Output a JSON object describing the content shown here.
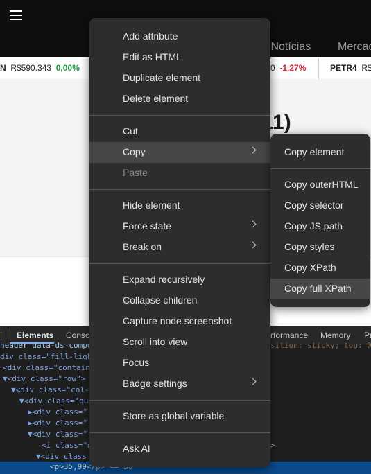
{
  "page": {
    "nav_links": [
      "s Notícias",
      "Mercad"
    ],
    "ticker": [
      {
        "symbol": "N",
        "price": "R$590.343",
        "change": "0,00%",
        "dir": "up"
      },
      {
        "symbol": "",
        "price": "0",
        "change": "-1,27%",
        "dir": "down"
      },
      {
        "symbol": "PETR4",
        "price": "R$",
        "change": "",
        "dir": ""
      }
    ],
    "headline_fragment": "11)"
  },
  "devtools": {
    "tabs": [
      "Elements",
      "Conso",
      "rformance",
      "Memory",
      "Pr"
    ],
    "active_tab": "Elements",
    "code_lines": [
      "header data-ds-compo",
      "div class=\"fill-ligh",
      "<div class=\"containe",
      "▼<div class=\"row\">",
      "▼<div class=\"col-",
      "▼<div class=\"qu",
      "▶<div class=\"",
      "▶<div class=\"",
      "▼<div class=\"",
      "<i class=\"m",
      "▼<div class",
      "<p>35,99</p> == $0"
    ],
    "right_code_fragments": [
      "sition: sticky; top: 0p",
      ">"
    ]
  },
  "context_menu": {
    "groups": [
      [
        {
          "label": "Add attribute"
        },
        {
          "label": "Edit as HTML"
        },
        {
          "label": "Duplicate element"
        },
        {
          "label": "Delete element"
        }
      ],
      [
        {
          "label": "Cut"
        },
        {
          "label": "Copy",
          "submenu": true,
          "highlighted": true
        },
        {
          "label": "Paste",
          "disabled": true
        }
      ],
      [
        {
          "label": "Hide element"
        },
        {
          "label": "Force state",
          "submenu": true
        },
        {
          "label": "Break on",
          "submenu": true
        }
      ],
      [
        {
          "label": "Expand recursively"
        },
        {
          "label": "Collapse children"
        },
        {
          "label": "Capture node screenshot"
        },
        {
          "label": "Scroll into view"
        },
        {
          "label": "Focus"
        },
        {
          "label": "Badge settings",
          "submenu": true
        }
      ],
      [
        {
          "label": "Store as global variable"
        }
      ],
      [
        {
          "label": "Ask AI"
        }
      ]
    ]
  },
  "copy_submenu": {
    "groups": [
      [
        {
          "label": "Copy element"
        }
      ],
      [
        {
          "label": "Copy outerHTML"
        },
        {
          "label": "Copy selector"
        },
        {
          "label": "Copy JS path"
        },
        {
          "label": "Copy styles"
        },
        {
          "label": "Copy XPath"
        },
        {
          "label": "Copy full XPath",
          "highlighted": true
        }
      ]
    ]
  },
  "colors": {
    "menu_bg": "#2d2d2d",
    "menu_highlight": "#474747",
    "positive": "#1b9a3e",
    "negative": "#d7262d",
    "devtools_selected_row": "#0a4a8a"
  }
}
